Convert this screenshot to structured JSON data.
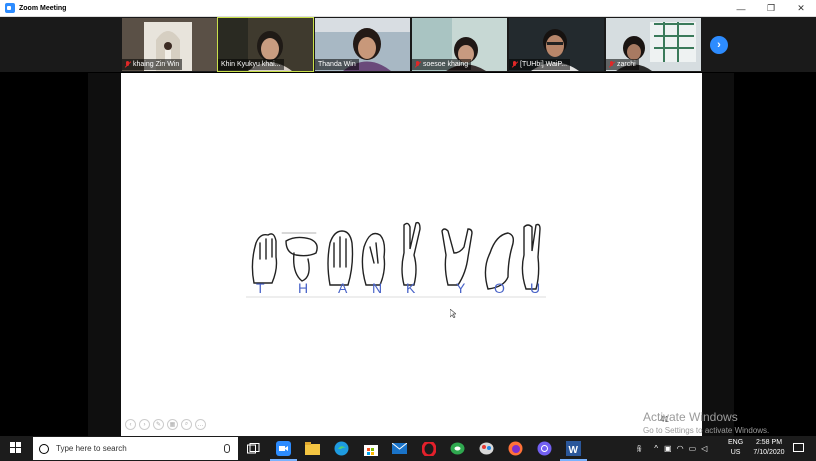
{
  "window": {
    "title": "Zoom Meeting",
    "minimize": "—",
    "maximize": "❐",
    "close": "✕"
  },
  "participants": [
    {
      "name": "khaing Zin Win",
      "muted": true
    },
    {
      "name": "Khin Kyukyu khai...",
      "muted": false,
      "active": true
    },
    {
      "name": "Thanda Win",
      "muted": false
    },
    {
      "name": "soesoe khaing",
      "muted": true
    },
    {
      "name": "[TUHbi] WaiP...",
      "muted": true
    },
    {
      "name": "zarchi",
      "muted": true
    }
  ],
  "gallery_next_icon": "chevron-right-icon",
  "slide": {
    "letters": [
      "T",
      "H",
      "A",
      "N",
      "K",
      "Y",
      "O",
      "U"
    ],
    "page_number": "41"
  },
  "watermark": {
    "line1": "Activate Windows",
    "line2": "Go to Settings to activate Windows."
  },
  "taskbar": {
    "search_placeholder": "Type here to search",
    "language": "ENG",
    "region": "US",
    "time": "2:58 PM",
    "date": "7/10/2020"
  },
  "colors": {
    "zoom_blue": "#2d8cff",
    "letter_blue": "#4a64c8",
    "active_border": "#c9e04a"
  }
}
